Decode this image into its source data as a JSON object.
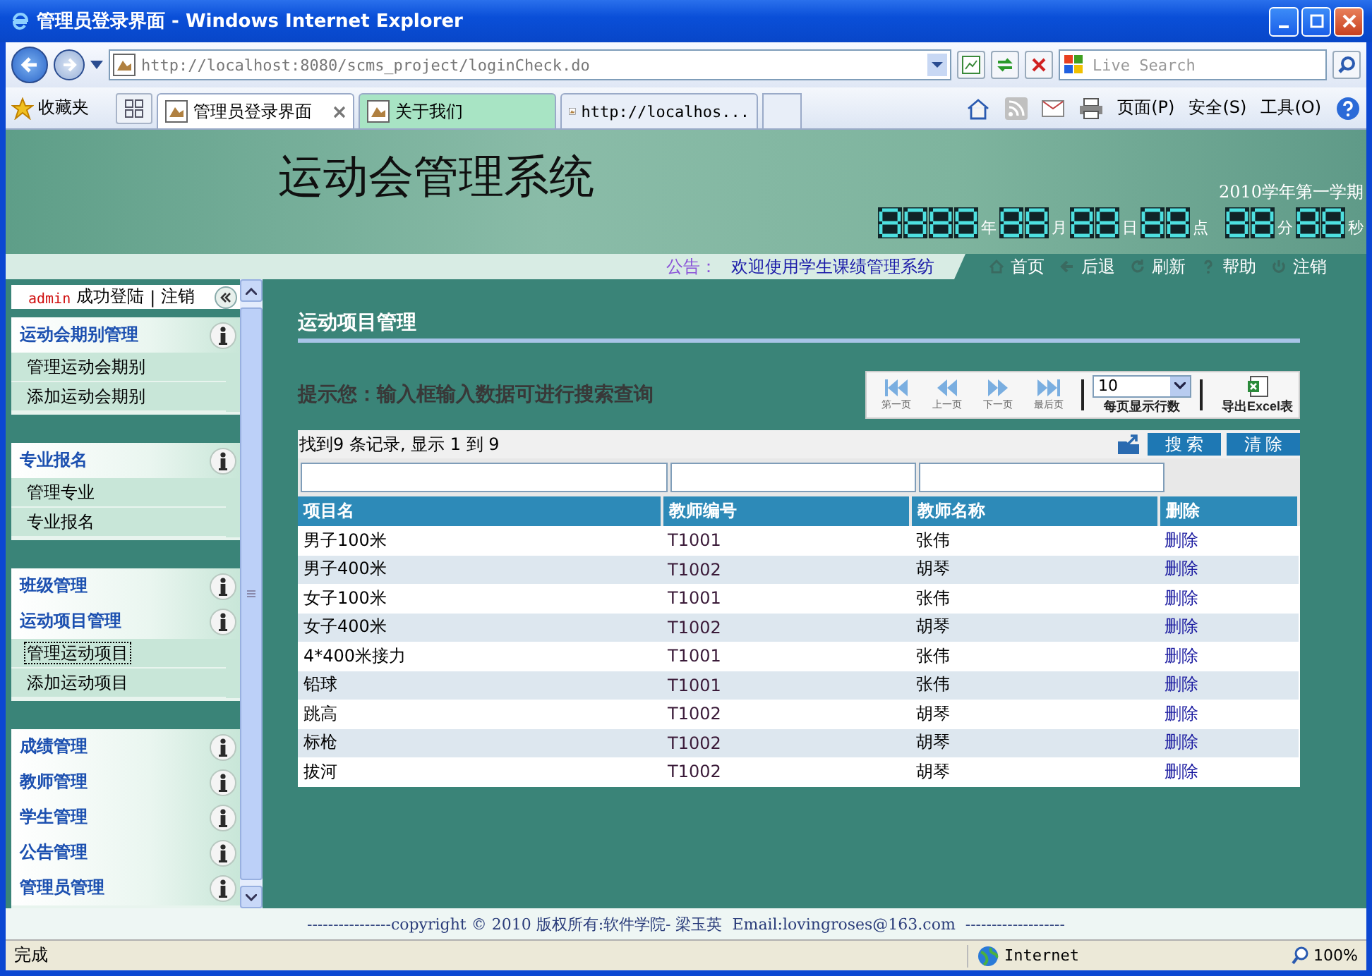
{
  "window": {
    "title": "管理员登录界面 - Windows Internet Explorer"
  },
  "address_bar": {
    "url": "http://localhost:8080/scms_project/loginCheck.do",
    "search_placeholder": "Live Search"
  },
  "favorites": {
    "label": "收藏夹"
  },
  "tabs": [
    {
      "label": "管理员登录界面",
      "selected": true
    },
    {
      "label": "关于我们",
      "selected": false
    },
    {
      "label": "http://localhos...",
      "selected": false
    }
  ],
  "command_bar": [
    "页面(P)",
    "安全(S)",
    "工具(O)"
  ],
  "banner": {
    "title": "运动会管理系统",
    "term": "2010学年第一学期",
    "clock_units": [
      "年",
      "月",
      "日",
      "点",
      "分",
      "秒"
    ]
  },
  "notice": {
    "label": "公告：",
    "text": "欢迎使用学生课绩管理系纺"
  },
  "nav_links": [
    {
      "kind": "home",
      "label": "首页"
    },
    {
      "kind": "back",
      "label": "后退"
    },
    {
      "kind": "refresh",
      "label": "刷新"
    },
    {
      "kind": "help",
      "label": "帮助"
    },
    {
      "kind": "logout",
      "label": "注销"
    }
  ],
  "login_bar": {
    "user": "admin",
    "status": "成功登陆",
    "separator": "|",
    "logout": "注销"
  },
  "sidebar": {
    "panels": [
      {
        "sections": [
          {
            "title": "运动会期别管理",
            "items": [
              {
                "label": "管理运动会期别",
                "selected": false
              },
              {
                "label": "添加运动会期别",
                "selected": false
              }
            ]
          }
        ]
      },
      {
        "sections": [
          {
            "title": "专业报名",
            "items": [
              {
                "label": "管理专业",
                "selected": false
              },
              {
                "label": "专业报名",
                "selected": false
              }
            ]
          }
        ]
      },
      {
        "sections": [
          {
            "title": "班级管理"
          },
          {
            "title": "运动项目管理",
            "items": [
              {
                "label": "管理运动项目",
                "selected": true
              },
              {
                "label": "添加运动项目",
                "selected": false
              }
            ]
          }
        ]
      },
      {
        "sections": [
          {
            "title": "成绩管理"
          },
          {
            "title": "教师管理"
          },
          {
            "title": "学生管理"
          },
          {
            "title": "公告管理"
          },
          {
            "title": "管理员管理"
          }
        ]
      }
    ]
  },
  "main": {
    "title": "运动项目管理",
    "hint": "提示您：输入框输入数据可进行搜索查询",
    "pager": [
      {
        "kind": "first",
        "label": "第一页"
      },
      {
        "kind": "prev",
        "label": "上一页"
      },
      {
        "kind": "next",
        "label": "下一页"
      },
      {
        "kind": "last",
        "label": "最后页"
      }
    ],
    "page_size": {
      "value": "10",
      "label": "每页显示行数"
    },
    "export": {
      "label": "导出Excel表"
    },
    "record_info": "找到9 条记录, 显示  1 到  9",
    "search_button": "搜 索",
    "clear_button": "清 除",
    "table": {
      "columns": [
        "项目名",
        "教师编号",
        "教师名称",
        "删除"
      ],
      "rows": [
        [
          "男子100米",
          "T1001",
          "张伟",
          "删除"
        ],
        [
          "男子400米",
          "T1002",
          "胡琴",
          "删除"
        ],
        [
          "女子100米",
          "T1001",
          "张伟",
          "删除"
        ],
        [
          "女子400米",
          "T1002",
          "胡琴",
          "删除"
        ],
        [
          "4*400米接力",
          "T1001",
          "张伟",
          "删除"
        ],
        [
          "铅球",
          "T1001",
          "张伟",
          "删除"
        ],
        [
          "跳高",
          "T1002",
          "胡琴",
          "删除"
        ],
        [
          "标枪",
          "T1002",
          "胡琴",
          "删除"
        ],
        [
          "拔河",
          "T1002",
          "胡琴",
          "删除"
        ]
      ]
    }
  },
  "footer": "----------------copyright © 2010 版权所有:软件学院- 梁玉英  Email:lovingroses@163.com  -------------------",
  "status_bar": {
    "text": "完成",
    "zone": "Internet",
    "zoom": "100%"
  }
}
